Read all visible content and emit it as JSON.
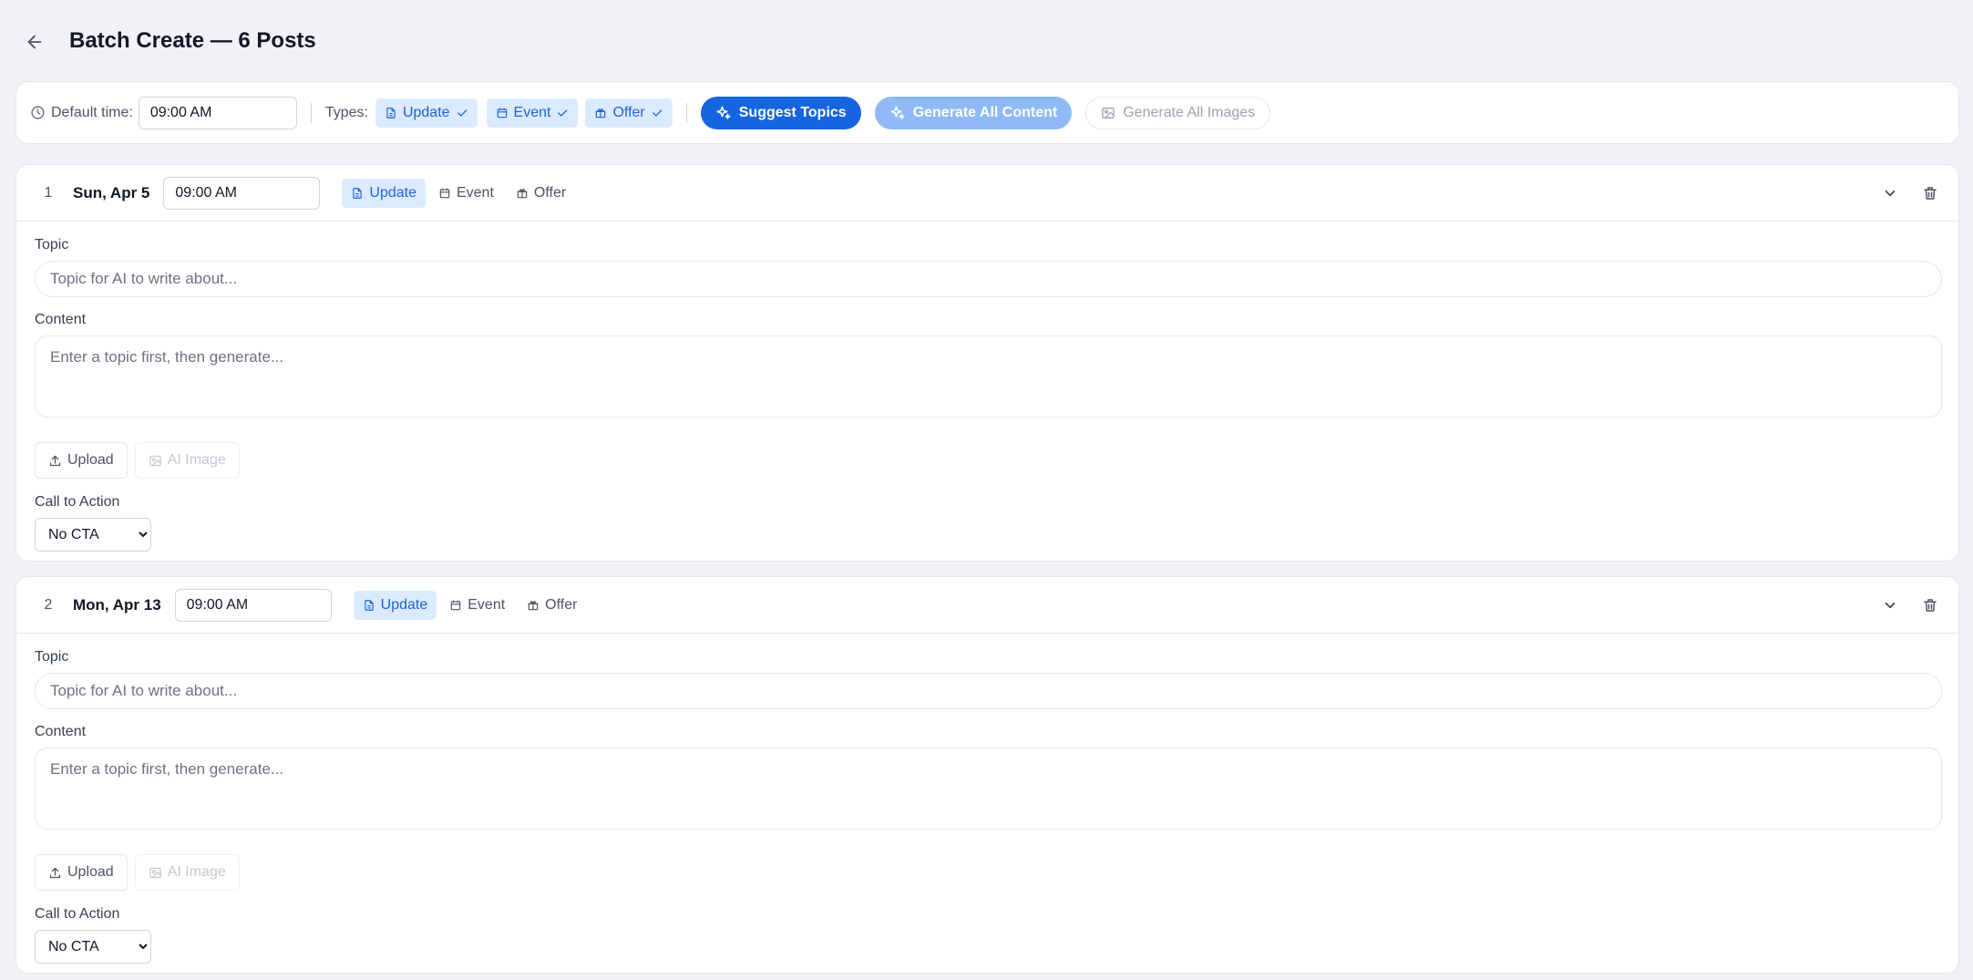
{
  "header": {
    "title": "Batch Create — 6 Posts"
  },
  "toolbar": {
    "default_time_label": "Default time:",
    "default_time_value": "09:00  AM",
    "types_label": "Types:",
    "types": [
      {
        "label": "Update",
        "icon": "document-icon",
        "checked": true
      },
      {
        "label": "Event",
        "icon": "calendar-icon",
        "checked": true
      },
      {
        "label": "Offer",
        "icon": "gift-icon",
        "checked": true
      }
    ],
    "suggest_topics_label": "Suggest Topics",
    "generate_content_label": "Generate All Content",
    "generate_images_label": "Generate All Images"
  },
  "posts": [
    {
      "number": "1",
      "date": "Sun, Apr 5",
      "time": "09:00  AM",
      "type_options": [
        {
          "label": "Update",
          "icon": "document-icon",
          "active": true
        },
        {
          "label": "Event",
          "icon": "calendar-icon",
          "active": false
        },
        {
          "label": "Offer",
          "icon": "gift-icon",
          "active": false
        }
      ],
      "topic_label": "Topic",
      "topic_placeholder": "Topic for AI to write about...",
      "content_label": "Content",
      "content_placeholder": "Enter a topic first, then generate...",
      "upload_label": "Upload",
      "ai_image_label": "AI Image",
      "cta_label": "Call to Action",
      "cta_value": "No CTA"
    },
    {
      "number": "2",
      "date": "Mon, Apr 13",
      "time": "09:00  AM",
      "type_options": [
        {
          "label": "Update",
          "icon": "document-icon",
          "active": true
        },
        {
          "label": "Event",
          "icon": "calendar-icon",
          "active": false
        },
        {
          "label": "Offer",
          "icon": "gift-icon",
          "active": false
        }
      ],
      "topic_label": "Topic",
      "topic_placeholder": "Topic for AI to write about...",
      "content_label": "Content",
      "content_placeholder": "Enter a topic first, then generate...",
      "upload_label": "Upload",
      "ai_image_label": "AI Image",
      "cta_label": "Call to Action",
      "cta_value": "No CTA"
    }
  ],
  "colors": {
    "page_bg": "#f0f2f7",
    "primary": "#1665e0",
    "primary_disabled": "#8fbaf5",
    "chip_bg": "#dbeafe",
    "chip_text": "#1d63d8"
  }
}
